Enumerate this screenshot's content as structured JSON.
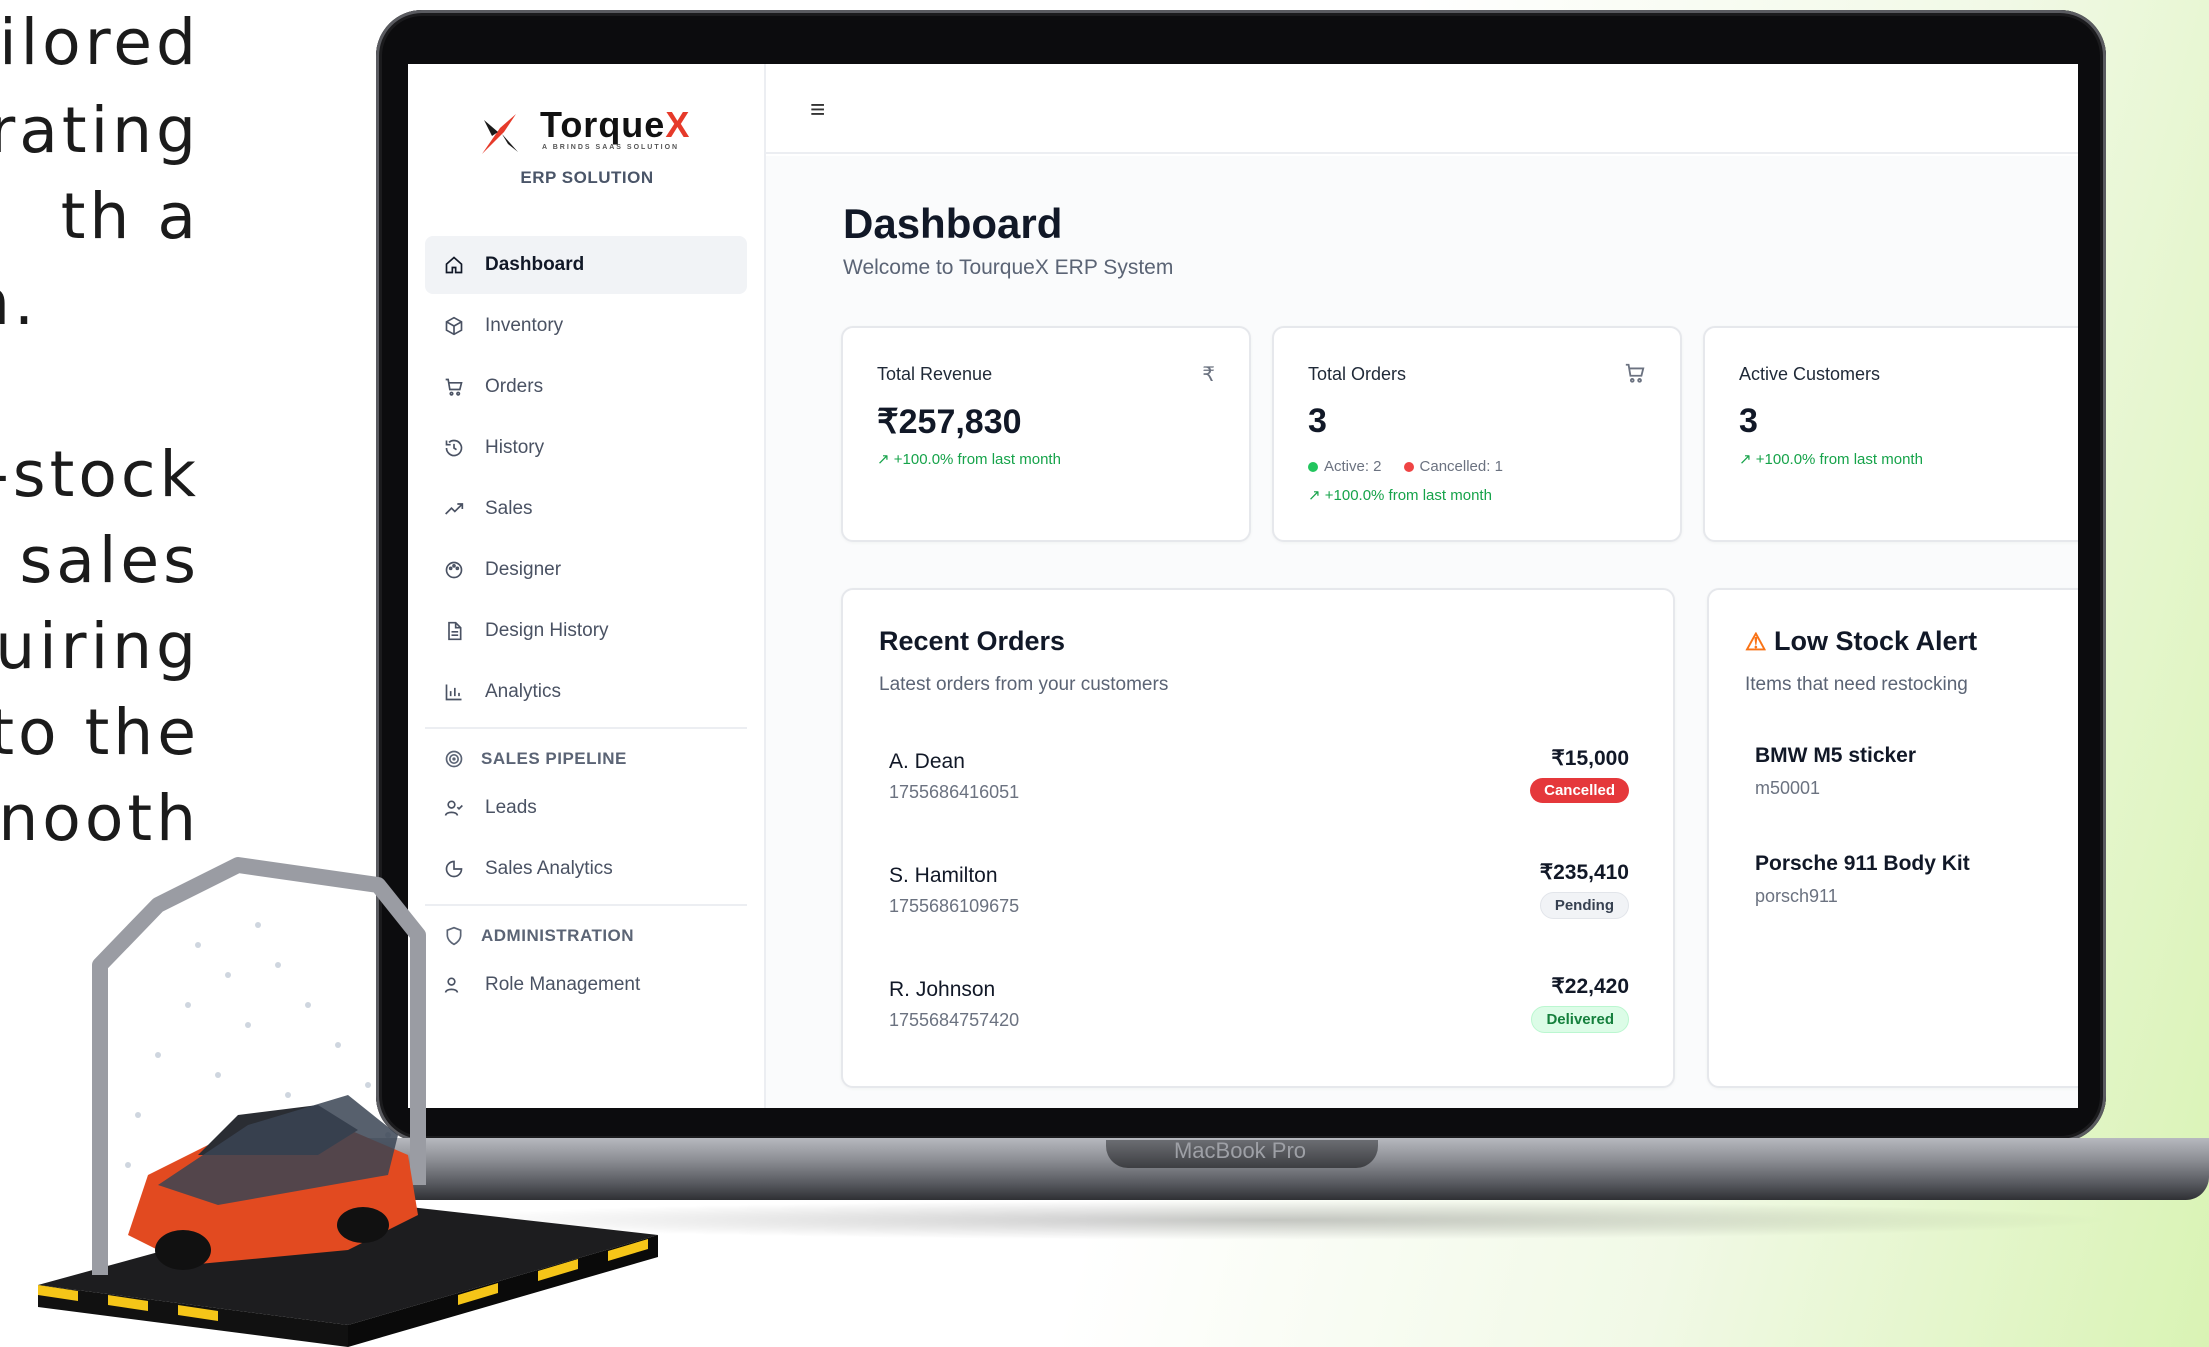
{
  "side_text": [
    "ilored",
    "rating",
    "th    a",
    "n.",
    "-stock",
    " sales",
    "uiring",
    "to the",
    "nooth"
  ],
  "device": {
    "label": "MacBook Pro"
  },
  "brand": {
    "name_main": "Torque",
    "name_accent": "X",
    "tagline": "A BRINDS SAAS SOLUTION",
    "subtitle": "ERP SOLUTION"
  },
  "sidebar": {
    "items": [
      {
        "label": "Dashboard",
        "icon": "home-icon",
        "active": true
      },
      {
        "label": "Inventory",
        "icon": "box-icon"
      },
      {
        "label": "Orders",
        "icon": "cart-icon"
      },
      {
        "label": "History",
        "icon": "history-icon"
      },
      {
        "label": "Sales",
        "icon": "trend-icon"
      },
      {
        "label": "Designer",
        "icon": "palette-icon"
      },
      {
        "label": "Design History",
        "icon": "document-icon"
      },
      {
        "label": "Analytics",
        "icon": "bar-chart-icon"
      }
    ],
    "section_pipeline": "SALES PIPELINE",
    "pipeline_items": [
      {
        "label": "Leads",
        "icon": "user-check-icon"
      },
      {
        "label": "Sales Analytics",
        "icon": "pie-icon"
      }
    ],
    "section_admin": "ADMINISTRATION",
    "admin_items": [
      {
        "label": "Role Management",
        "icon": "role-icon"
      }
    ]
  },
  "header": {
    "menu_icon": "hamburger-icon"
  },
  "page": {
    "title": "Dashboard",
    "subtitle": "Welcome to TourqueX ERP System"
  },
  "stats": {
    "revenue": {
      "title": "Total Revenue",
      "icon": "rupee-icon",
      "value": "₹257,830",
      "trend": "+100.0% from last month"
    },
    "orders": {
      "title": "Total Orders",
      "icon": "cart-icon",
      "value": "3",
      "active": "Active: 2",
      "cancelled": "Cancelled: 1",
      "trend": "+100.0% from last month"
    },
    "customers": {
      "title": "Active Customers",
      "icon": "users-icon",
      "value": "3",
      "trend": "+100.0% from last month"
    }
  },
  "recent_orders": {
    "title": "Recent Orders",
    "subtitle": "Latest orders from your customers",
    "rows": [
      {
        "name": "A. Dean",
        "id": "1755686416051",
        "amount": "₹15,000",
        "status": "Cancelled"
      },
      {
        "name": "S. Hamilton",
        "id": "1755686109675",
        "amount": "₹235,410",
        "status": "Pending"
      },
      {
        "name": "R. Johnson",
        "id": "1755684757420",
        "amount": "₹22,420",
        "status": "Delivered"
      }
    ]
  },
  "low_stock": {
    "title": "Low Stock Alert",
    "subtitle": "Items that need restocking",
    "items": [
      {
        "name": "BMW M5 sticker",
        "sku": "m50001"
      },
      {
        "name": "Porsche 911 Body Kit",
        "sku": "porsch911"
      }
    ]
  },
  "colors": {
    "accent_red": "#e63a2a",
    "success": "#16a34a",
    "danger": "#e5383b",
    "warning": "#f97316"
  }
}
